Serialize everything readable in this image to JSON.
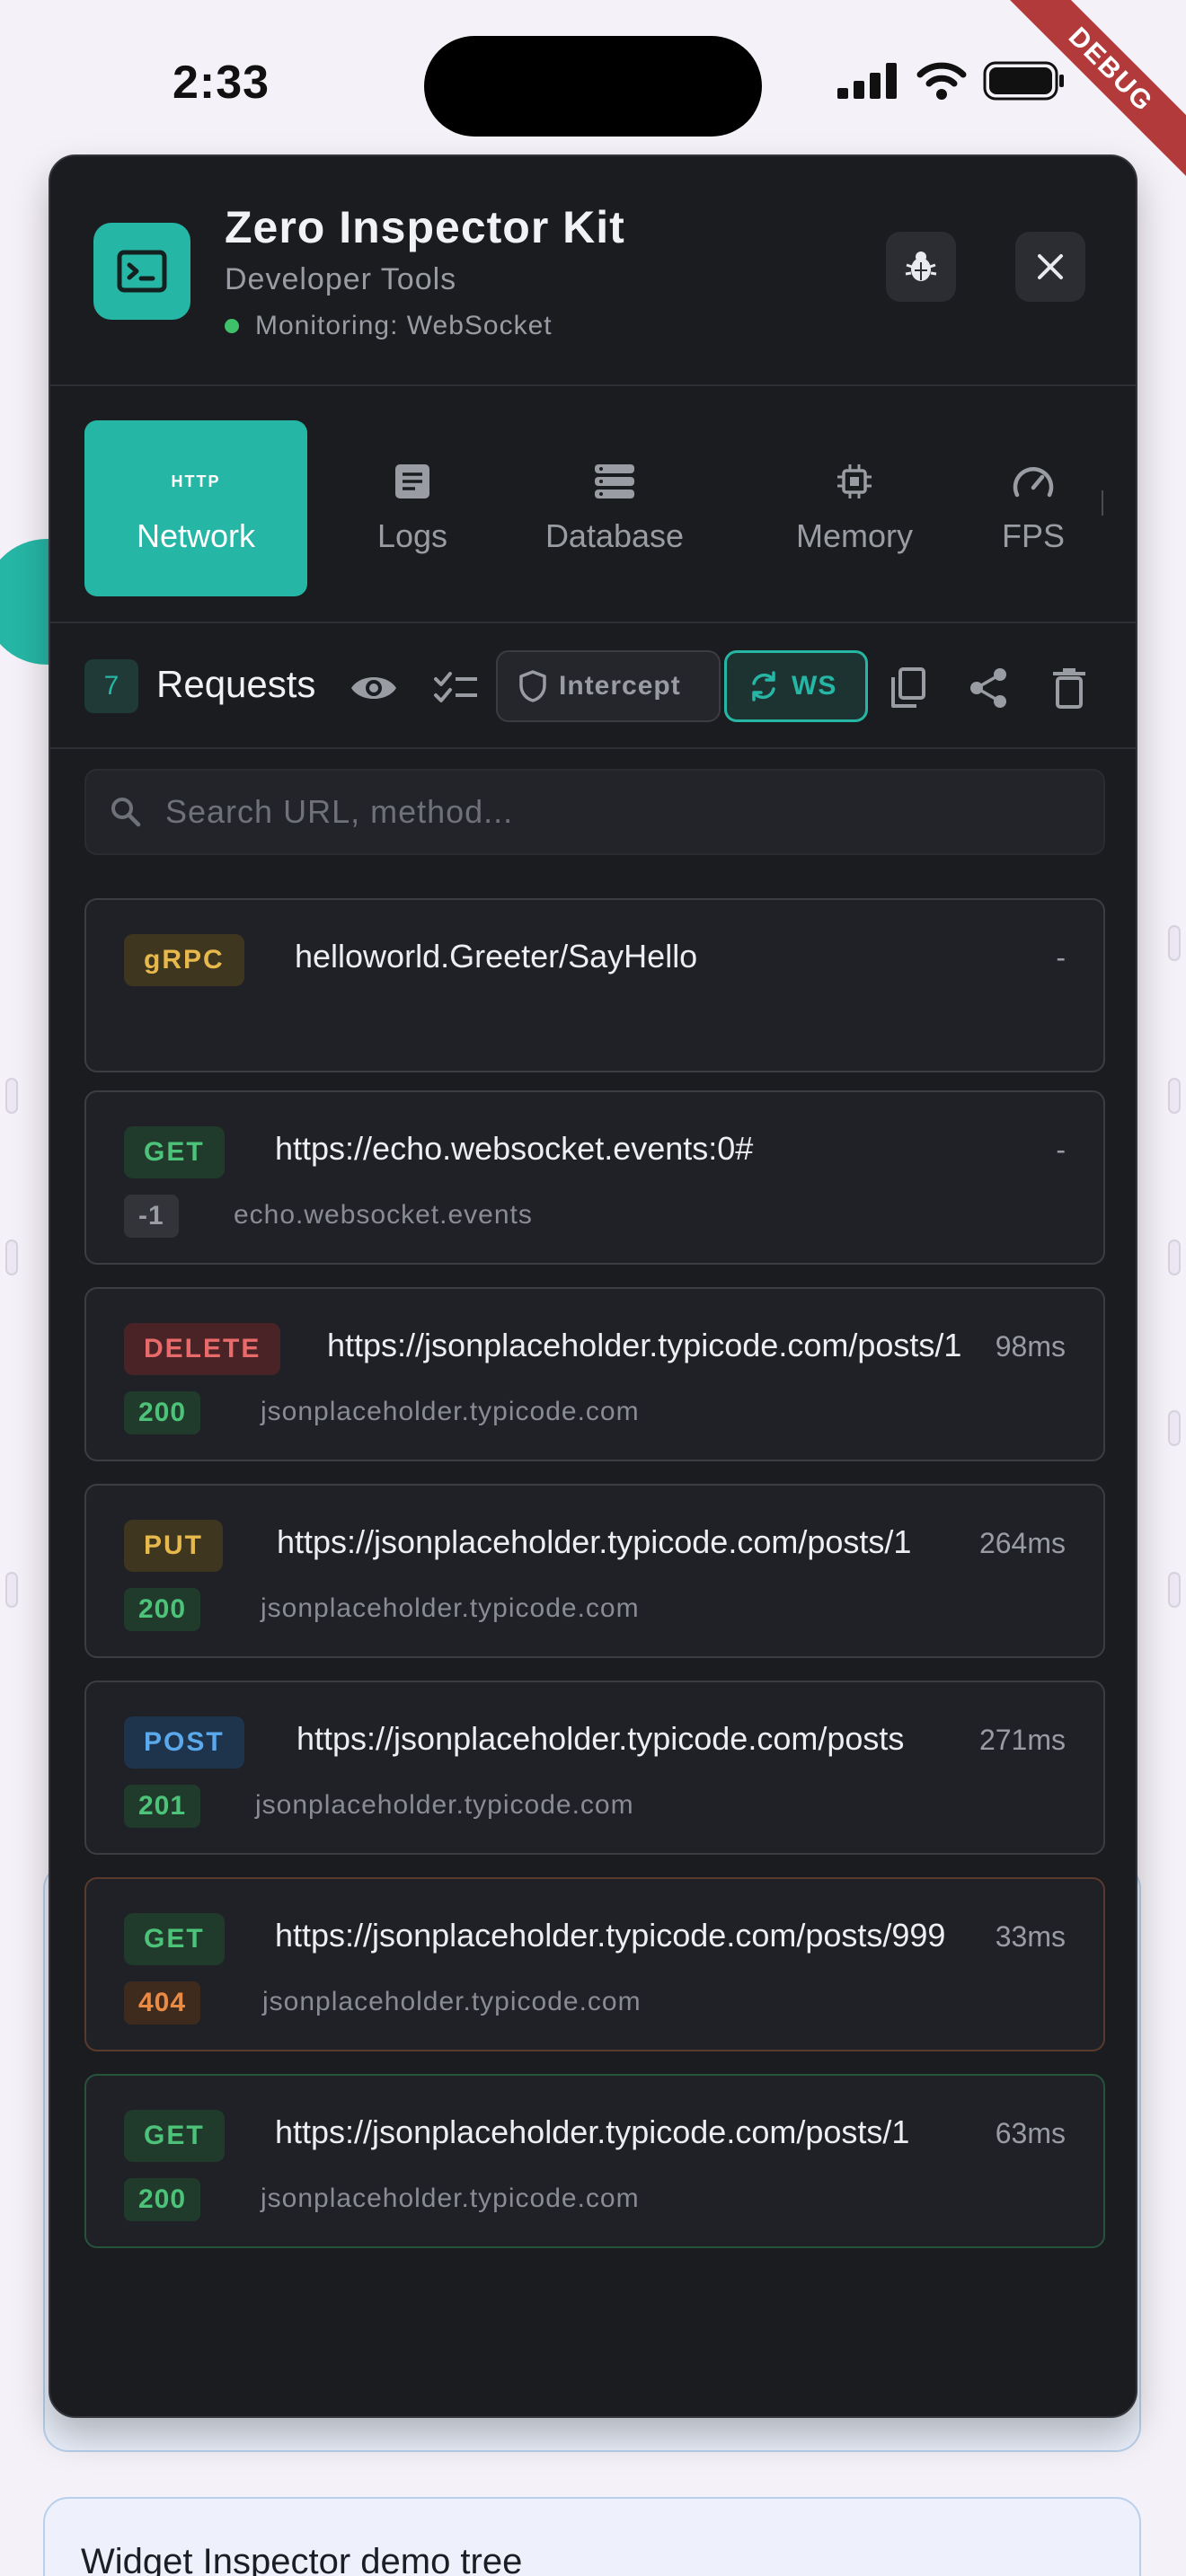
{
  "status_bar": {
    "time": "2:33",
    "debug_label": "DEBUG"
  },
  "background": {
    "card_title": "Widget Inspector demo tree"
  },
  "header": {
    "title": "Zero Inspector Kit",
    "subtitle": "Developer Tools",
    "monitoring": "Monitoring: WebSocket"
  },
  "tabs": [
    {
      "label": "Network",
      "badge": "HTTP",
      "icon": "http-icon",
      "active": true
    },
    {
      "label": "Logs",
      "icon": "document-icon"
    },
    {
      "label": "Database",
      "icon": "database-icon"
    },
    {
      "label": "Memory",
      "icon": "chip-icon"
    },
    {
      "label": "FPS",
      "icon": "speedometer-icon"
    }
  ],
  "toolbar": {
    "count": "7",
    "label": "Requests",
    "intercept_label": "Intercept",
    "ws_label": "WS"
  },
  "search": {
    "placeholder": "Search URL, method..."
  },
  "requests": [
    {
      "method": "gRPC",
      "url": "helloworld.Greeter/SayHello",
      "time": "-",
      "status": "",
      "host": ""
    },
    {
      "method": "GET",
      "url": "https://echo.websocket.events:0#",
      "time": "-",
      "status": "-1",
      "host": "echo.websocket.events"
    },
    {
      "method": "DELETE",
      "url": "https://jsonplaceholder.typicode.com/posts/1",
      "time": "98ms",
      "status": "200",
      "host": "jsonplaceholder.typicode.com"
    },
    {
      "method": "PUT",
      "url": "https://jsonplaceholder.typicode.com/posts/1",
      "time": "264ms",
      "status": "200",
      "host": "jsonplaceholder.typicode.com"
    },
    {
      "method": "POST",
      "url": "https://jsonplaceholder.typicode.com/posts",
      "time": "271ms",
      "status": "201",
      "host": "jsonplaceholder.typicode.com"
    },
    {
      "method": "GET",
      "url": "https://jsonplaceholder.typicode.com/posts/999",
      "time": "33ms",
      "status": "404",
      "host": "jsonplaceholder.typicode.com"
    },
    {
      "method": "GET",
      "url": "https://jsonplaceholder.typicode.com/posts/1",
      "time": "63ms",
      "status": "200",
      "host": "jsonplaceholder.typicode.com"
    }
  ],
  "colors": {
    "accent": "#26b6a5",
    "panel": "#1b1c20",
    "success": "#4dc37a",
    "warning": "#e7b84b",
    "error": "#e86a6a"
  }
}
